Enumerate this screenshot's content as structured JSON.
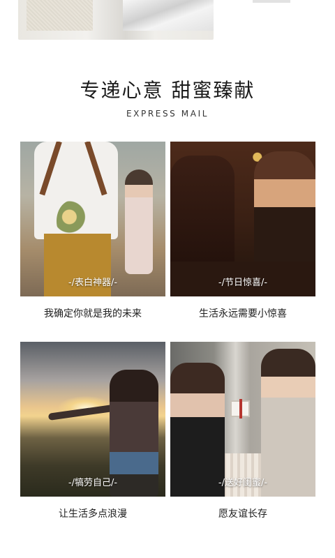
{
  "header": {
    "title": "专递心意  甜蜜臻献",
    "subtitle": "EXPRESS MAIL"
  },
  "cards": [
    {
      "tag": "-/表白神器/-",
      "caption": "我确定你就是我的未来"
    },
    {
      "tag": "-/节日惊喜/-",
      "caption": "生活永远需要小惊喜"
    },
    {
      "tag": "-/犒劳自己/-",
      "caption": "让生活多点浪漫"
    },
    {
      "tag": "-/送好闺蜜/-",
      "caption": "愿友谊长存"
    }
  ],
  "colors": {
    "background": "#ffffff",
    "text": "#1b1b1b",
    "tag_text": "#ffffff"
  }
}
